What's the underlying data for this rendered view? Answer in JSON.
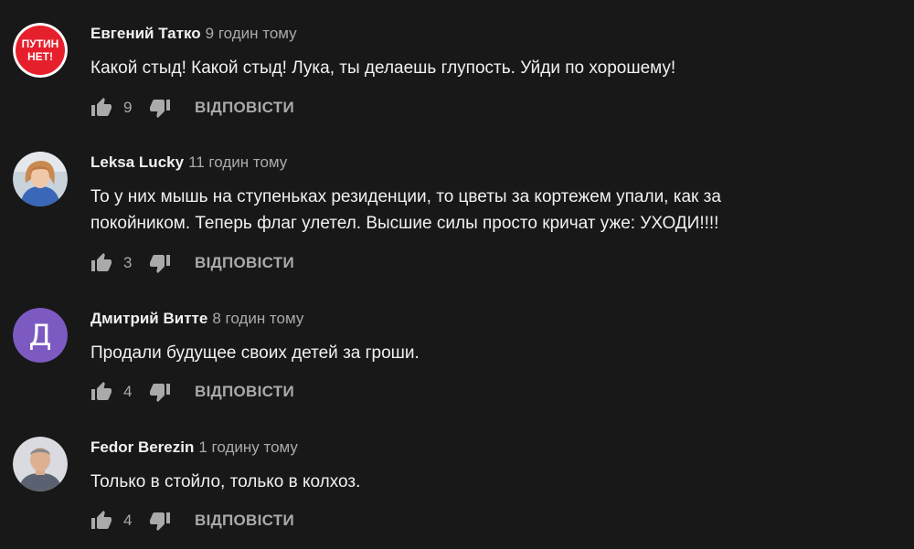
{
  "reply_label": "ВІДПОВІСТИ",
  "colors": {
    "background": "#181818",
    "text": "#f1f1f1",
    "secondary": "#aaaaaa",
    "badge_red": "#e5202c",
    "letter_avatar_purple": "#7c5ac2"
  },
  "comments": [
    {
      "author": "Евгений Татко",
      "time": "9 годин тому",
      "text": "Какой стыд! Какой стыд! Лука, ты делаешь глупость. Уйди по хорошему!",
      "likes": "9",
      "avatar": {
        "type": "badge",
        "line1": "ПУТИН",
        "line2": "НЕТ!"
      }
    },
    {
      "author": "Leksa Lucky",
      "time": "11 годин тому",
      "text": "То у них мышь на ступеньках резиденции, то цветы за кортежем упали, как за покойником. Теперь флаг улетел. Высшие силы просто кричат уже: УХОДИ!!!!",
      "likes": "3",
      "avatar": {
        "type": "photo-woman"
      }
    },
    {
      "author": "Дмитрий Витте",
      "time": "8 годин тому",
      "text": "Продали будущее своих детей за гроши.",
      "likes": "4",
      "avatar": {
        "type": "letter",
        "letter": "Д"
      }
    },
    {
      "author": "Fedor Berezin",
      "time": "1 годину тому",
      "text": "Только в стойло, только в колхоз.",
      "likes": "4",
      "avatar": {
        "type": "photo-man"
      }
    }
  ]
}
